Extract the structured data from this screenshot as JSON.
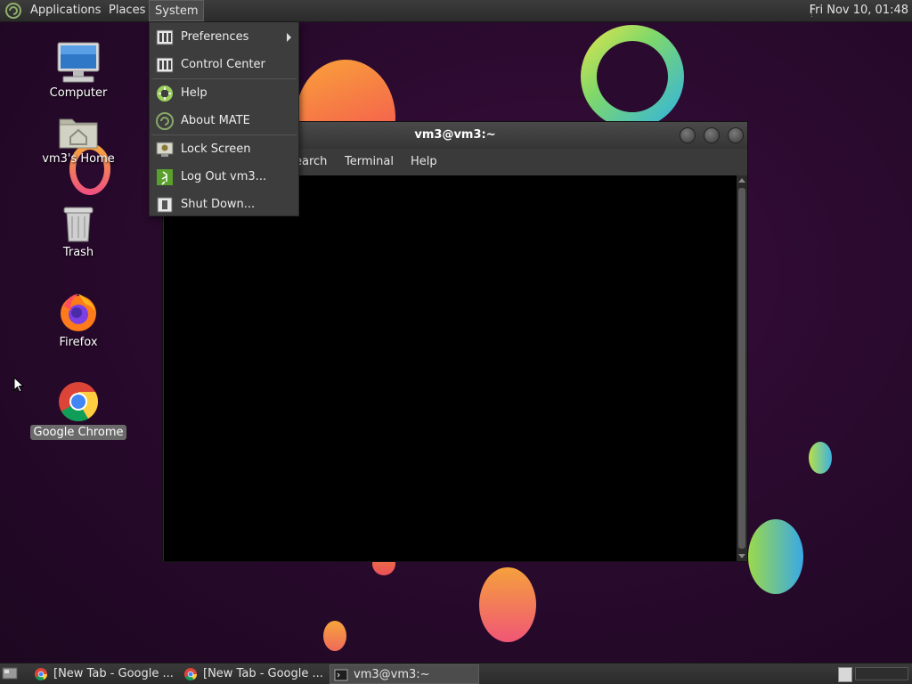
{
  "top_panel": {
    "menus": [
      "Applications",
      "Places",
      "System"
    ],
    "clock": "Fri Nov 10, 01:48"
  },
  "desktop_icons": [
    {
      "label": "Computer",
      "icon": "computer-icon"
    },
    {
      "label": "vm3's Home",
      "icon": "home-folder-icon"
    },
    {
      "label": "Trash",
      "icon": "trash-icon"
    },
    {
      "label": "Firefox",
      "icon": "firefox-icon"
    },
    {
      "label": "Google Chrome",
      "icon": "chrome-icon"
    }
  ],
  "system_menu": {
    "items": [
      {
        "label": "Preferences",
        "icon": "preferences-icon",
        "has_submenu": true
      },
      {
        "label": "Control Center",
        "icon": "control-center-icon"
      },
      {
        "label": "Help",
        "icon": "help-icon"
      },
      {
        "label": "About MATE",
        "icon": "mate-icon"
      },
      {
        "label": "Lock Screen",
        "icon": "lock-screen-icon"
      },
      {
        "label": "Log Out vm3...",
        "icon": "logout-icon"
      },
      {
        "label": "Shut Down...",
        "icon": "shutdown-icon"
      }
    ]
  },
  "terminal": {
    "title": "vm3@vm3:~",
    "menu_visible": [
      "earch",
      "Terminal",
      "Help"
    ]
  },
  "taskbar": {
    "tasks": [
      {
        "label": "[New Tab - Google ...",
        "icon": "chrome-icon"
      },
      {
        "label": "[New Tab - Google ...",
        "icon": "chrome-icon"
      },
      {
        "label": "vm3@vm3:~",
        "icon": "terminal-icon",
        "active": true
      }
    ]
  }
}
